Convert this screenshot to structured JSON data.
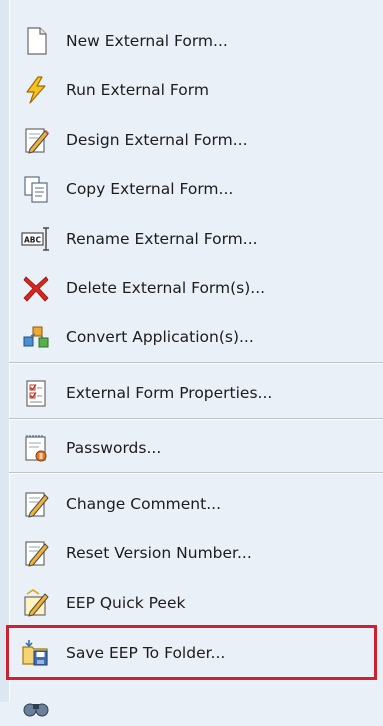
{
  "menu": {
    "items": [
      {
        "label": "New External Form...",
        "icon": "new-document-icon"
      },
      {
        "label": "Run External Form",
        "icon": "lightning-bolt-icon"
      },
      {
        "label": "Design External Form...",
        "icon": "design-pencil-icon"
      },
      {
        "label": "Copy External Form...",
        "icon": "copy-documents-icon"
      },
      {
        "label": "Rename External Form...",
        "icon": "rename-abc-icon"
      },
      {
        "label": "Delete External Form(s)...",
        "icon": "delete-x-icon"
      },
      {
        "label": "Convert Application(s)...",
        "icon": "convert-puzzle-icon"
      },
      {
        "label": "External Form Properties...",
        "icon": "properties-checklist-icon"
      },
      {
        "label": "Passwords...",
        "icon": "passwords-notepad-icon"
      },
      {
        "label": "Change Comment...",
        "icon": "comment-pencil-icon"
      },
      {
        "label": "Reset Version Number...",
        "icon": "reset-pencil-icon"
      },
      {
        "label": "EEP Quick Peek",
        "icon": "quick-peek-icon"
      },
      {
        "label": "Save EEP To Folder...",
        "icon": "save-to-folder-icon"
      },
      {
        "label": "",
        "icon": "binoculars-icon"
      }
    ],
    "highlighted_item": "Save EEP To Folder...",
    "colors": {
      "background": "#e9f0f7",
      "highlight_border": "#d01f2e",
      "separator": "#b9c5d3"
    }
  }
}
